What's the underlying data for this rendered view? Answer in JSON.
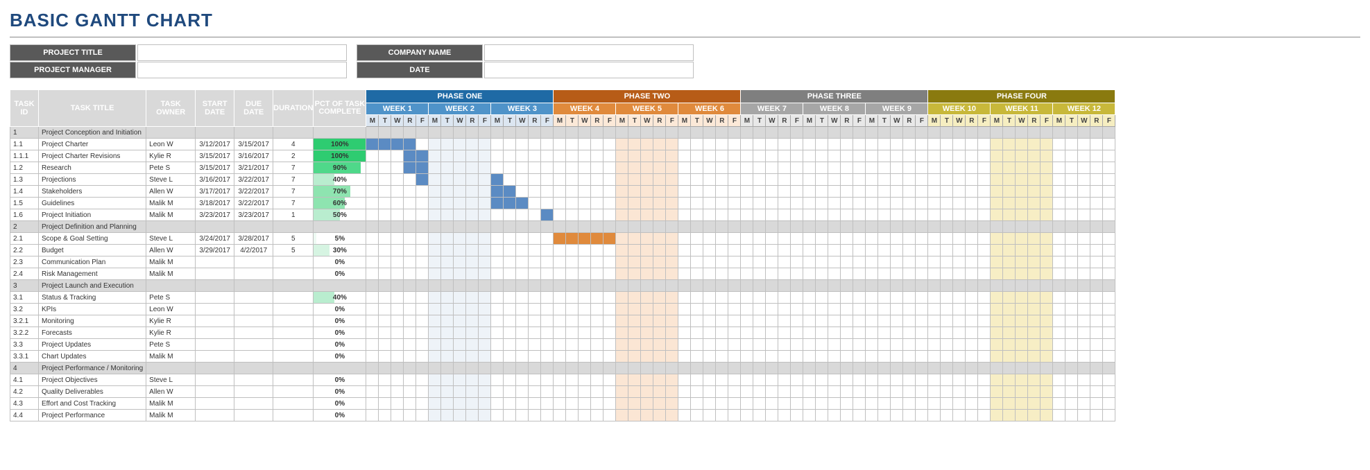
{
  "title": "BASIC GANTT CHART",
  "form": {
    "project_title_lbl": "PROJECT TITLE",
    "project_title_val": "",
    "project_manager_lbl": "PROJECT MANAGER",
    "project_manager_val": "",
    "company_name_lbl": "COMPANY NAME",
    "company_name_val": "",
    "date_lbl": "DATE",
    "date_val": ""
  },
  "columns": {
    "task_id": "TASK ID",
    "task_title": "TASK TITLE",
    "task_owner": "TASK OWNER",
    "start_date": "START DATE",
    "due_date": "DUE  DATE",
    "duration": "DURATION",
    "pct": "PCT OF TASK COMPLETE"
  },
  "phases": [
    {
      "name": "PHASE ONE",
      "weeks": [
        "WEEK 1",
        "WEEK 2",
        "WEEK 3"
      ],
      "cls": "ph1"
    },
    {
      "name": "PHASE TWO",
      "weeks": [
        "WEEK 4",
        "WEEK 5",
        "WEEK 6"
      ],
      "cls": "ph2"
    },
    {
      "name": "PHASE THREE",
      "weeks": [
        "WEEK 7",
        "WEEK 8",
        "WEEK 9"
      ],
      "cls": "ph3"
    },
    {
      "name": "PHASE FOUR",
      "weeks": [
        "WEEK 10",
        "WEEK 11",
        "WEEK 12"
      ],
      "cls": "ph4"
    }
  ],
  "days": [
    "M",
    "T",
    "W",
    "R",
    "F"
  ],
  "shaded_weeks": [
    1,
    4,
    10
  ],
  "tasks": [
    {
      "id": "1",
      "sect": true,
      "title": "Project Conception and Initiation"
    },
    {
      "id": "1.1",
      "title": "Project Charter",
      "owner": "Leon W",
      "start": "3/12/2017",
      "due": "3/15/2017",
      "dur": "4",
      "pct": 100,
      "bar": [
        0,
        4
      ],
      "barColor": "bar1"
    },
    {
      "id": "1.1.1",
      "title": "Project Charter Revisions",
      "owner": "Kylie R",
      "start": "3/15/2017",
      "due": "3/16/2017",
      "dur": "2",
      "pct": 100,
      "bar": [
        3,
        5
      ],
      "barColor": "bar1"
    },
    {
      "id": "1.2",
      "title": "Research",
      "owner": "Pete S",
      "start": "3/15/2017",
      "due": "3/21/2017",
      "dur": "7",
      "pct": 90,
      "bar": [
        3,
        10
      ],
      "barColor": "bar1"
    },
    {
      "id": "1.3",
      "title": "Projections",
      "owner": "Steve L",
      "start": "3/16/2017",
      "due": "3/22/2017",
      "dur": "7",
      "pct": 40,
      "bar": [
        4,
        11
      ],
      "barColor": "bar1"
    },
    {
      "id": "1.4",
      "title": "Stakeholders",
      "owner": "Allen W",
      "start": "3/17/2017",
      "due": "3/22/2017",
      "dur": "7",
      "pct": 70,
      "bar": [
        5,
        12
      ],
      "barColor": "bar1"
    },
    {
      "id": "1.5",
      "title": "Guidelines",
      "owner": "Malik M",
      "start": "3/18/2017",
      "due": "3/22/2017",
      "dur": "7",
      "pct": 60,
      "bar": [
        6,
        13
      ],
      "barColor": "bar1"
    },
    {
      "id": "1.6",
      "title": "Project Initiation",
      "owner": "Malik M",
      "start": "3/23/2017",
      "due": "3/23/2017",
      "dur": "1",
      "pct": 50,
      "bar": [
        14,
        15
      ],
      "barColor": "bar1"
    },
    {
      "id": "2",
      "sect": true,
      "title": "Project Definition and Planning"
    },
    {
      "id": "2.1",
      "title": "Scope & Goal Setting",
      "owner": "Steve L",
      "start": "3/24/2017",
      "due": "3/28/2017",
      "dur": "5",
      "pct": 5,
      "bar": [
        15,
        20
      ],
      "barColor": "bar2"
    },
    {
      "id": "2.2",
      "title": "Budget",
      "owner": "Allen W",
      "start": "3/29/2017",
      "due": "4/2/2017",
      "dur": "5",
      "pct": 30,
      "bar": [
        20,
        25
      ],
      "barColor": "bar2"
    },
    {
      "id": "2.3",
      "title": "Communication Plan",
      "owner": "Malik M",
      "pct": 0
    },
    {
      "id": "2.4",
      "title": "Risk Management",
      "owner": "Malik M",
      "pct": 0
    },
    {
      "id": "3",
      "sect": true,
      "title": "Project Launch and Execution"
    },
    {
      "id": "3.1",
      "title": "Status & Tracking",
      "owner": "Pete S",
      "pct": 40
    },
    {
      "id": "3.2",
      "title": "KPIs",
      "owner": "Leon W",
      "pct": 0
    },
    {
      "id": "3.2.1",
      "title": "Monitoring",
      "owner": "Kylie R",
      "pct": 0
    },
    {
      "id": "3.2.2",
      "title": "Forecasts",
      "owner": "Kylie R",
      "pct": 0
    },
    {
      "id": "3.3",
      "title": "Project Updates",
      "owner": "Pete S",
      "pct": 0
    },
    {
      "id": "3.3.1",
      "title": "Chart Updates",
      "owner": "Malik M",
      "pct": 0
    },
    {
      "id": "4",
      "sect": true,
      "title": "Project Performance / Monitoring"
    },
    {
      "id": "4.1",
      "title": "Project Objectives",
      "owner": "Steve L",
      "pct": 0
    },
    {
      "id": "4.2",
      "title": "Quality Deliverables",
      "owner": "Allen W",
      "pct": 0
    },
    {
      "id": "4.3",
      "title": "Effort and Cost Tracking",
      "owner": "Malik M",
      "pct": 0
    },
    {
      "id": "4.4",
      "title": "Project Performance",
      "owner": "Malik M",
      "pct": 0
    }
  ],
  "chart_data": {
    "type": "gantt",
    "time_axis": {
      "unit": "day",
      "start": "2017-03-12",
      "weeks": 12,
      "days_per_week": 5,
      "day_labels": [
        "M",
        "T",
        "W",
        "R",
        "F"
      ]
    },
    "phases": [
      {
        "name": "PHASE ONE",
        "weeks": [
          1,
          2,
          3
        ]
      },
      {
        "name": "PHASE TWO",
        "weeks": [
          4,
          5,
          6
        ]
      },
      {
        "name": "PHASE THREE",
        "weeks": [
          7,
          8,
          9
        ]
      },
      {
        "name": "PHASE FOUR",
        "weeks": [
          10,
          11,
          12
        ]
      }
    ],
    "highlight_weeks": [
      2,
      5,
      11
    ],
    "tasks": [
      {
        "id": "1.1",
        "name": "Project Charter",
        "owner": "Leon W",
        "start": "2017-03-12",
        "end": "2017-03-15",
        "duration": 4,
        "pct_complete": 100,
        "phase": 1
      },
      {
        "id": "1.1.1",
        "name": "Project Charter Revisions",
        "owner": "Kylie R",
        "start": "2017-03-15",
        "end": "2017-03-16",
        "duration": 2,
        "pct_complete": 100,
        "phase": 1
      },
      {
        "id": "1.2",
        "name": "Research",
        "owner": "Pete S",
        "start": "2017-03-15",
        "end": "2017-03-21",
        "duration": 7,
        "pct_complete": 90,
        "phase": 1
      },
      {
        "id": "1.3",
        "name": "Projections",
        "owner": "Steve L",
        "start": "2017-03-16",
        "end": "2017-03-22",
        "duration": 7,
        "pct_complete": 40,
        "phase": 1
      },
      {
        "id": "1.4",
        "name": "Stakeholders",
        "owner": "Allen W",
        "start": "2017-03-17",
        "end": "2017-03-22",
        "duration": 7,
        "pct_complete": 70,
        "phase": 1
      },
      {
        "id": "1.5",
        "name": "Guidelines",
        "owner": "Malik M",
        "start": "2017-03-18",
        "end": "2017-03-22",
        "duration": 7,
        "pct_complete": 60,
        "phase": 1
      },
      {
        "id": "1.6",
        "name": "Project Initiation",
        "owner": "Malik M",
        "start": "2017-03-23",
        "end": "2017-03-23",
        "duration": 1,
        "pct_complete": 50,
        "phase": 1
      },
      {
        "id": "2.1",
        "name": "Scope & Goal Setting",
        "owner": "Steve L",
        "start": "2017-03-24",
        "end": "2017-03-28",
        "duration": 5,
        "pct_complete": 5,
        "phase": 2
      },
      {
        "id": "2.2",
        "name": "Budget",
        "owner": "Allen W",
        "start": "2017-03-29",
        "end": "2017-04-02",
        "duration": 5,
        "pct_complete": 30,
        "phase": 2
      },
      {
        "id": "2.3",
        "name": "Communication Plan",
        "owner": "Malik M",
        "pct_complete": 0,
        "phase": 2
      },
      {
        "id": "2.4",
        "name": "Risk Management",
        "owner": "Malik M",
        "pct_complete": 0,
        "phase": 2
      },
      {
        "id": "3.1",
        "name": "Status & Tracking",
        "owner": "Pete S",
        "pct_complete": 40,
        "phase": 3
      },
      {
        "id": "3.2",
        "name": "KPIs",
        "owner": "Leon W",
        "pct_complete": 0,
        "phase": 3
      },
      {
        "id": "3.2.1",
        "name": "Monitoring",
        "owner": "Kylie R",
        "pct_complete": 0,
        "phase": 3
      },
      {
        "id": "3.2.2",
        "name": "Forecasts",
        "owner": "Kylie R",
        "pct_complete": 0,
        "phase": 3
      },
      {
        "id": "3.3",
        "name": "Project Updates",
        "owner": "Pete S",
        "pct_complete": 0,
        "phase": 3
      },
      {
        "id": "3.3.1",
        "name": "Chart Updates",
        "owner": "Malik M",
        "pct_complete": 0,
        "phase": 3
      },
      {
        "id": "4.1",
        "name": "Project Objectives",
        "owner": "Steve L",
        "pct_complete": 0,
        "phase": 4
      },
      {
        "id": "4.2",
        "name": "Quality Deliverables",
        "owner": "Allen W",
        "pct_complete": 0,
        "phase": 4
      },
      {
        "id": "4.3",
        "name": "Effort and Cost Tracking",
        "owner": "Malik M",
        "pct_complete": 0,
        "phase": 4
      },
      {
        "id": "4.4",
        "name": "Project Performance",
        "owner": "Malik M",
        "pct_complete": 0,
        "phase": 4
      }
    ]
  }
}
